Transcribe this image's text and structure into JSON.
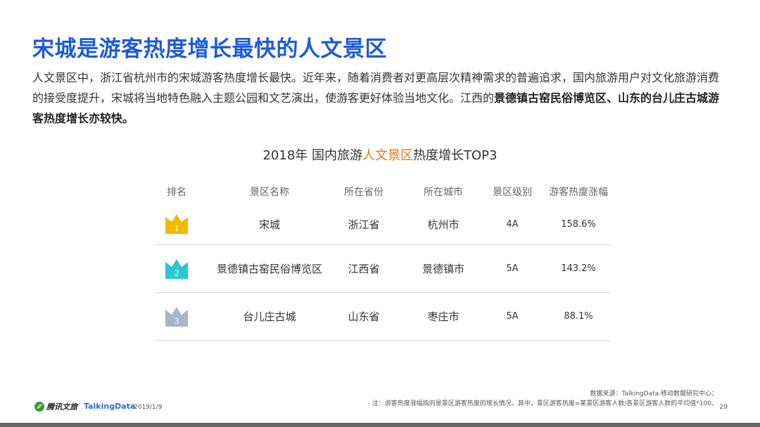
{
  "title": "宋城是游客热度增长最快的人文景区",
  "intro": {
    "text1": "人文景区中，浙江省杭州市的宋城游客热度增长最快。近年来，随着消费者对更高层次精神需求的普遍追求，国内旅游用户对文化旅游消费的接受度提升，宋城将当地特色融入主题公园和文艺演出，使游客更好体验当地文化。江西的",
    "bold": "景德镇古窑民俗博览区、山东的台儿庄古城游客热度增长亦较快。"
  },
  "table_title": {
    "prefix": "2018年 国内旅游",
    "accent": "人文景区",
    "suffix": "热度增长TOP3"
  },
  "accent_color": "#e07a1f",
  "headers": [
    "排名",
    "景区名称",
    "所在省份",
    "所在城市",
    "景区级别",
    "游客热度涨幅"
  ],
  "rows": [
    {
      "rank": "1",
      "crown_color": "#f5b800",
      "name": "宋城",
      "province": "浙江省",
      "city": "杭州市",
      "level": "4A",
      "growth": "158.6%"
    },
    {
      "rank": "2",
      "crown_color": "#2ec7cf",
      "name": "景德镇古窑民俗博览区",
      "province": "江西省",
      "city": "景德镇市",
      "level": "5A",
      "growth": "143.2%"
    },
    {
      "rank": "3",
      "crown_color": "#a8b4c8",
      "name": "台儿庄古城",
      "province": "山东省",
      "city": "枣庄市",
      "level": "5A",
      "growth": "88.1%"
    }
  ],
  "footer": {
    "source": "数据来源：TalkingData 移动数据研究中心；",
    "note": "注：游客热度涨幅指的是景区游客热度的增长情况，其中，景区游客热度=某景区游客人数/各景区游客人数的平均值*100。",
    "page": "29",
    "logo1": "腾讯文旅",
    "logo2": "TalkingData",
    "date": "2019/1/9"
  }
}
